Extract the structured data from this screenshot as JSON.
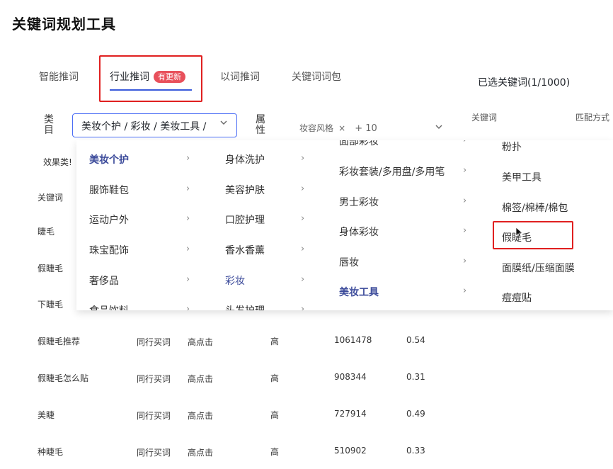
{
  "page_title": "关键词规划工具",
  "tabs": [
    {
      "label": "智能推词"
    },
    {
      "label": "行业推词",
      "badge": "有更新"
    },
    {
      "label": "以词推词"
    },
    {
      "label": "关键词词包"
    }
  ],
  "selected_panel": {
    "title": "已选关键词(1/1000)",
    "col_keyword": "关键词",
    "col_match": "匹配方式"
  },
  "filters": {
    "category_label": "类目",
    "category_value": "美妆个护 / 彩妆 / 美妆工具 /",
    "attribute_label": "属性",
    "attribute_tag": "妆容风格",
    "attribute_more": "+ 10",
    "effect_label": "效果类!"
  },
  "side_list": {
    "header": "关键词",
    "items": [
      "睫毛",
      "假睫毛",
      "下睫毛"
    ]
  },
  "cascader": {
    "col1": [
      "美妆个护",
      "服饰鞋包",
      "运动户外",
      "珠宝配饰",
      "奢侈品",
      "食品饮料"
    ],
    "col2": [
      "身体洗护",
      "美容护肤",
      "口腔护理",
      "香水香薰",
      "彩妆",
      "头发护理"
    ],
    "col3": [
      "面部彩妆",
      "彩妆套装/多用盘/多用笔",
      "男士彩妆",
      "身体彩妆",
      "唇妆",
      "美妆工具"
    ],
    "col4": [
      "粉扑",
      "美甲工具",
      "棉签/棉棒/棉包",
      "假睫毛",
      "面膜纸/压缩面膜",
      "痘痘贴"
    ]
  },
  "table_rows": [
    {
      "keyword": "假睫毛推荐",
      "source": "同行买词",
      "click": "高点击",
      "level": "高",
      "volume": "1061478",
      "ratio": "0.54"
    },
    {
      "keyword": "假睫毛怎么贴",
      "source": "同行买词",
      "click": "高点击",
      "level": "高",
      "volume": "908344",
      "ratio": "0.31"
    },
    {
      "keyword": "美睫",
      "source": "同行买词",
      "click": "高点击",
      "level": "高",
      "volume": "727914",
      "ratio": "0.49"
    },
    {
      "keyword": "种睫毛",
      "source": "同行买词",
      "click": "高点击",
      "level": "高",
      "volume": "510902",
      "ratio": "0.33"
    }
  ],
  "colors": {
    "accent": "#3b5bdb",
    "badge": "#e8505b",
    "highlight_box": "#e02020"
  }
}
